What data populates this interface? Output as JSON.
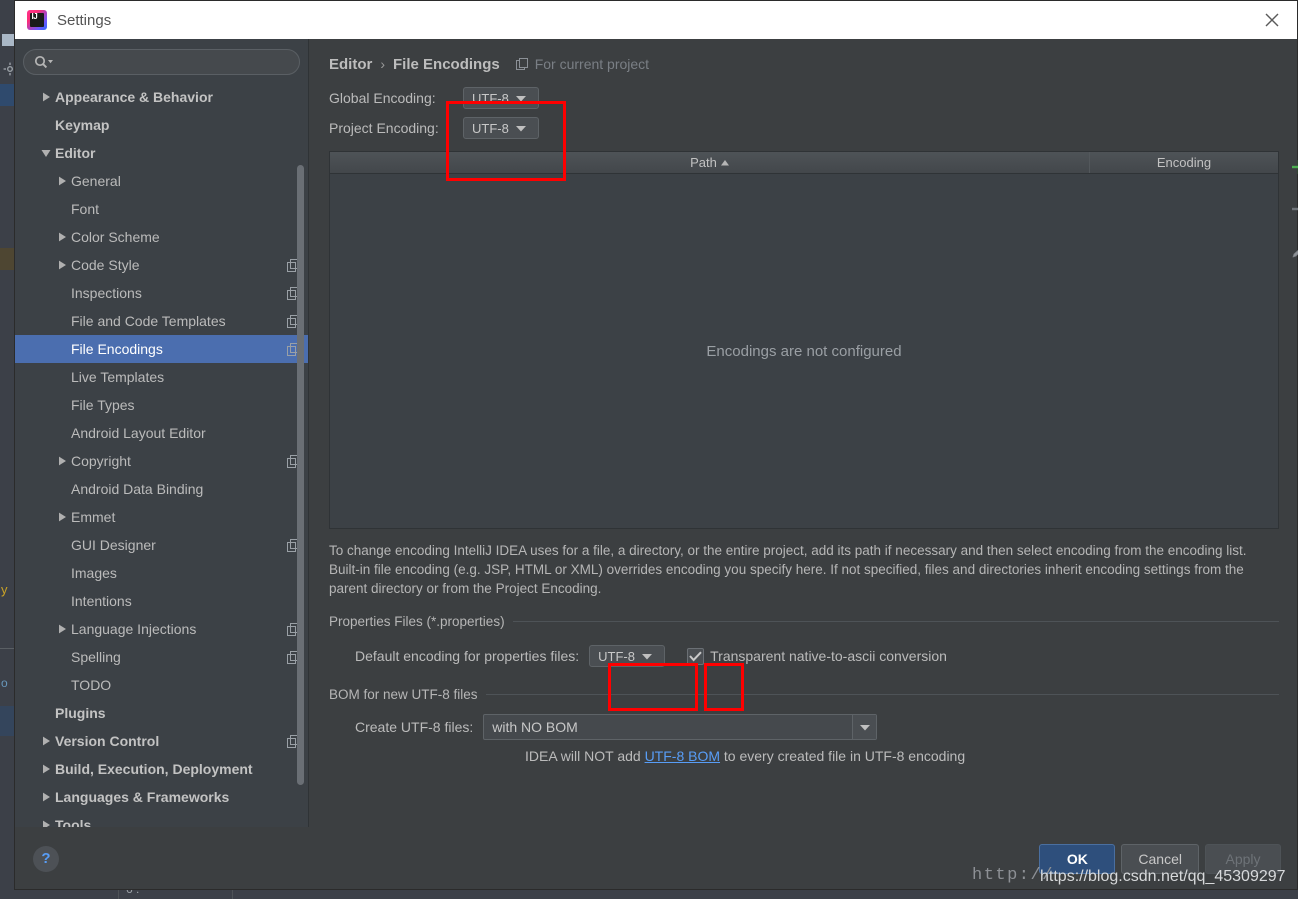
{
  "window": {
    "title": "Settings",
    "logo_text": "IJ",
    "close_icon": "close-icon"
  },
  "sidebar": {
    "search": {
      "value": "",
      "placeholder": ""
    },
    "items": [
      {
        "label": "Appearance & Behavior",
        "level": 0,
        "arrow": "right",
        "badge": false,
        "selected": false
      },
      {
        "label": "Keymap",
        "level": 0,
        "arrow": "none",
        "badge": false,
        "selected": false
      },
      {
        "label": "Editor",
        "level": 0,
        "arrow": "down",
        "badge": false,
        "selected": false
      },
      {
        "label": "General",
        "level": 1,
        "arrow": "right",
        "badge": false,
        "selected": false
      },
      {
        "label": "Font",
        "level": 1,
        "arrow": "none",
        "badge": false,
        "selected": false
      },
      {
        "label": "Color Scheme",
        "level": 1,
        "arrow": "right",
        "badge": false,
        "selected": false
      },
      {
        "label": "Code Style",
        "level": 1,
        "arrow": "right",
        "badge": true,
        "selected": false
      },
      {
        "label": "Inspections",
        "level": 1,
        "arrow": "none",
        "badge": true,
        "selected": false
      },
      {
        "label": "File and Code Templates",
        "level": 1,
        "arrow": "none",
        "badge": true,
        "selected": false
      },
      {
        "label": "File Encodings",
        "level": 1,
        "arrow": "none",
        "badge": true,
        "selected": true
      },
      {
        "label": "Live Templates",
        "level": 1,
        "arrow": "none",
        "badge": false,
        "selected": false
      },
      {
        "label": "File Types",
        "level": 1,
        "arrow": "none",
        "badge": false,
        "selected": false
      },
      {
        "label": "Android Layout Editor",
        "level": 1,
        "arrow": "none",
        "badge": false,
        "selected": false
      },
      {
        "label": "Copyright",
        "level": 1,
        "arrow": "right",
        "badge": true,
        "selected": false
      },
      {
        "label": "Android Data Binding",
        "level": 1,
        "arrow": "none",
        "badge": false,
        "selected": false
      },
      {
        "label": "Emmet",
        "level": 1,
        "arrow": "right",
        "badge": false,
        "selected": false
      },
      {
        "label": "GUI Designer",
        "level": 1,
        "arrow": "none",
        "badge": true,
        "selected": false
      },
      {
        "label": "Images",
        "level": 1,
        "arrow": "none",
        "badge": false,
        "selected": false
      },
      {
        "label": "Intentions",
        "level": 1,
        "arrow": "none",
        "badge": false,
        "selected": false
      },
      {
        "label": "Language Injections",
        "level": 1,
        "arrow": "right",
        "badge": true,
        "selected": false
      },
      {
        "label": "Spelling",
        "level": 1,
        "arrow": "none",
        "badge": true,
        "selected": false
      },
      {
        "label": "TODO",
        "level": 1,
        "arrow": "none",
        "badge": false,
        "selected": false
      },
      {
        "label": "Plugins",
        "level": 0,
        "arrow": "none",
        "badge": false,
        "selected": false
      },
      {
        "label": "Version Control",
        "level": 0,
        "arrow": "right",
        "badge": true,
        "selected": false
      },
      {
        "label": "Build, Execution, Deployment",
        "level": 0,
        "arrow": "right",
        "badge": false,
        "selected": false
      },
      {
        "label": "Languages & Frameworks",
        "level": 0,
        "arrow": "right",
        "badge": false,
        "selected": false
      },
      {
        "label": "Tools",
        "level": 0,
        "arrow": "right",
        "badge": false,
        "selected": false
      }
    ]
  },
  "main": {
    "breadcrumb": {
      "parent": "Editor",
      "separator": "›",
      "current": "File Encodings"
    },
    "for_current_project": "For current project",
    "global_encoding": {
      "label": "Global Encoding:",
      "value": "UTF-8"
    },
    "project_encoding": {
      "label": "Project Encoding:",
      "value": "UTF-8"
    },
    "table": {
      "columns": [
        "Path",
        "Encoding"
      ],
      "sort_indicator": "▲",
      "sorted_column": "Path",
      "rows": [],
      "empty_message": "Encodings are not configured",
      "toolbar": {
        "add": "+",
        "remove": "−",
        "edit": "pencil-icon"
      }
    },
    "description": "To change encoding IntelliJ IDEA uses for a file, a directory, or the entire project, add its path if necessary and then select encoding from the encoding list. Built-in file encoding (e.g. JSP, HTML or XML) overrides encoding you specify here. If not specified, files and directories inherit encoding settings from the parent directory or from the Project Encoding.",
    "properties_section": {
      "title": "Properties Files (*.properties)",
      "default_encoding_label": "Default encoding for properties files:",
      "default_encoding_value": "UTF-8",
      "transparent_label": "Transparent native-to-ascii conversion",
      "transparent_checked": true
    },
    "bom_section": {
      "title": "BOM for new UTF-8 files",
      "create_label": "Create UTF-8 files:",
      "create_value": "with NO BOM",
      "note_prefix": "IDEA will NOT add ",
      "note_link": "UTF-8 BOM",
      "note_suffix": " to every created file in UTF-8 encoding"
    }
  },
  "footer": {
    "help": "?",
    "ok": "OK",
    "cancel": "Cancel",
    "apply": "Apply"
  },
  "watermark": {
    "mono_text": "http://",
    "url_text": "https://blog.csdn.net/qq_45309297"
  },
  "colors": {
    "selection_blue": "#4b6eaf",
    "link_blue": "#589df6",
    "annotation_red": "#ff0000",
    "add_green": "#4caf50",
    "dialog_bg": "#3c3f41",
    "sidebar_bg": "#3c4146",
    "titlebar_bg": "#ffffff"
  }
}
